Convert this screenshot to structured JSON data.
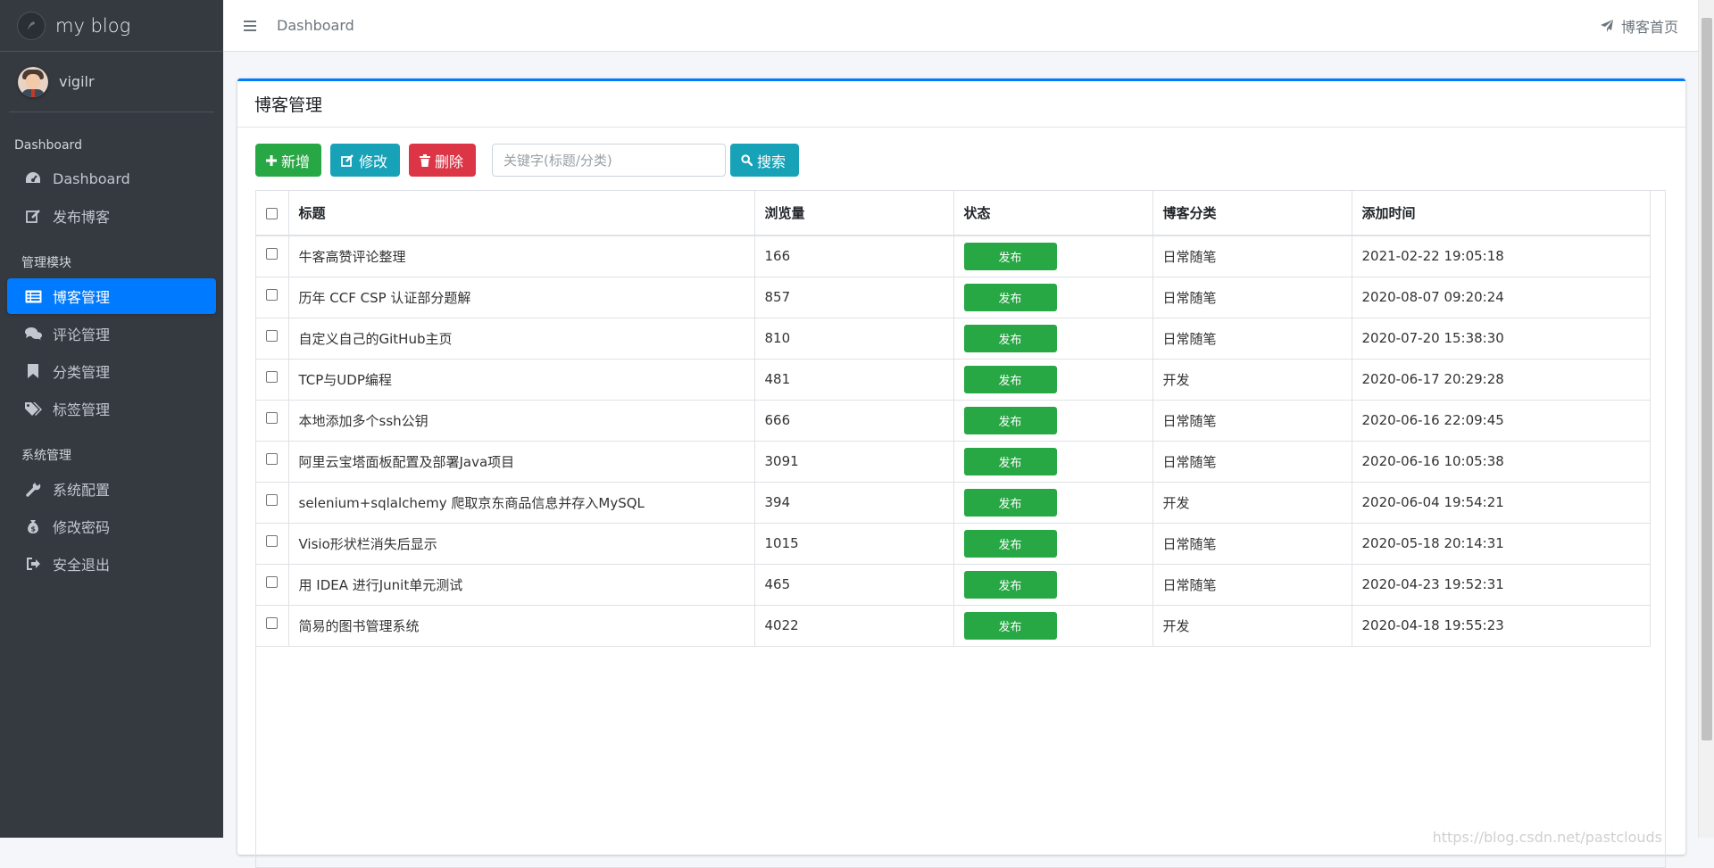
{
  "brand": {
    "name": "my blog"
  },
  "user": {
    "name": "vigilr"
  },
  "sidebar": {
    "sections": [
      {
        "header": "Dashboard",
        "items": [
          {
            "label": "Dashboard",
            "icon": "tachometer-icon"
          },
          {
            "label": "发布博客",
            "icon": "edit-icon"
          }
        ]
      },
      {
        "header": "管理模块",
        "items": [
          {
            "label": "博客管理",
            "icon": "list-icon",
            "active": true
          },
          {
            "label": "评论管理",
            "icon": "comments-icon"
          },
          {
            "label": "分类管理",
            "icon": "bookmark-icon"
          },
          {
            "label": "标签管理",
            "icon": "tags-icon"
          }
        ]
      },
      {
        "header": "系统管理",
        "items": [
          {
            "label": "系统配置",
            "icon": "wrench-icon"
          },
          {
            "label": "修改密码",
            "icon": "money-bag-icon"
          },
          {
            "label": "安全退出",
            "icon": "sign-out-icon"
          }
        ]
      }
    ]
  },
  "topbar": {
    "link": "Dashboard",
    "home_link": "博客首页"
  },
  "card": {
    "title": "博客管理"
  },
  "toolbar": {
    "add_label": "新增",
    "edit_label": "修改",
    "delete_label": "删除",
    "search_placeholder": "关键字(标题/分类)",
    "search_value": "",
    "search_label": "搜索"
  },
  "table": {
    "headers": [
      "标题",
      "浏览量",
      "状态",
      "博客分类",
      "添加时间"
    ],
    "rows": [
      {
        "title": "牛客高赞评论整理",
        "views": "166",
        "status": "发布",
        "category": "日常随笔",
        "time": "2021-02-22 19:05:18"
      },
      {
        "title": "历年 CCF CSP 认证部分题解",
        "views": "857",
        "status": "发布",
        "category": "日常随笔",
        "time": "2020-08-07 09:20:24"
      },
      {
        "title": "自定义自己的GitHub主页",
        "views": "810",
        "status": "发布",
        "category": "日常随笔",
        "time": "2020-07-20 15:38:30"
      },
      {
        "title": "TCP与UDP编程",
        "views": "481",
        "status": "发布",
        "category": "开发",
        "time": "2020-06-17 20:29:28"
      },
      {
        "title": "本地添加多个ssh公钥",
        "views": "666",
        "status": "发布",
        "category": "日常随笔",
        "time": "2020-06-16 22:09:45"
      },
      {
        "title": "阿里云宝塔面板配置及部署Java项目",
        "views": "3091",
        "status": "发布",
        "category": "日常随笔",
        "time": "2020-06-16 10:05:38"
      },
      {
        "title": "selenium+sqlalchemy 爬取京东商品信息并存入MySQL",
        "views": "394",
        "status": "发布",
        "category": "开发",
        "time": "2020-06-04 19:54:21"
      },
      {
        "title": "Visio形状栏消失后显示",
        "views": "1015",
        "status": "发布",
        "category": "日常随笔",
        "time": "2020-05-18 20:14:31"
      },
      {
        "title": "用 IDEA 进行Junit单元测试",
        "views": "465",
        "status": "发布",
        "category": "日常随笔",
        "time": "2020-04-23 19:52:31"
      },
      {
        "title": "简易的图书管理系统",
        "views": "4022",
        "status": "发布",
        "category": "开发",
        "time": "2020-04-18 19:55:23"
      }
    ]
  },
  "watermark": "https://blog.csdn.net/pastclouds",
  "colors": {
    "sidebar": "#343a40",
    "primary": "#007bff",
    "success": "#28a745",
    "info": "#17a2b8",
    "danger": "#dc3545"
  }
}
